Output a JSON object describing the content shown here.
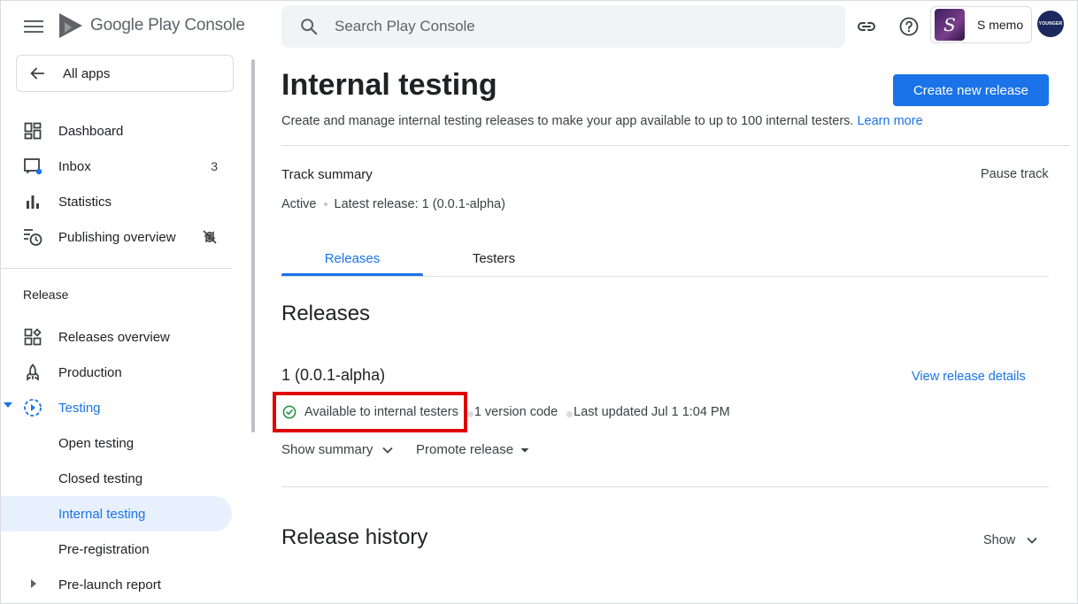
{
  "header": {
    "logo_text": "Google Play Console",
    "search_placeholder": "Search Play Console",
    "app_name": "S memo",
    "avatar_text": "YOUNGER"
  },
  "sidebar": {
    "all_apps": "All apps",
    "items": [
      {
        "label": "Dashboard",
        "icon": "dashboard-icon"
      },
      {
        "label": "Inbox",
        "icon": "inbox-icon",
        "badge": "3"
      },
      {
        "label": "Statistics",
        "icon": "bar-chart-icon"
      },
      {
        "label": "Publishing overview",
        "icon": "publishing-overview-icon"
      }
    ],
    "section_title": "Release",
    "release_items": [
      {
        "label": "Releases overview",
        "icon": "releases-overview-icon"
      },
      {
        "label": "Production",
        "icon": "production-icon"
      },
      {
        "label": "Testing",
        "icon": "testing-icon"
      },
      {
        "label": "Open testing"
      },
      {
        "label": "Closed testing"
      },
      {
        "label": "Internal testing"
      },
      {
        "label": "Pre-registration"
      },
      {
        "label": "Pre-launch report"
      }
    ]
  },
  "main": {
    "title": "Internal testing",
    "create_button": "Create new release",
    "description": "Create and manage internal testing releases to make your app available to up to 100 internal testers.",
    "learn_more": "Learn more",
    "track_summary": "Track summary",
    "pause_track": "Pause track",
    "track_state": "Active",
    "latest_release": "Latest release: 1 (0.0.1-alpha)",
    "tabs": [
      "Releases",
      "Testers"
    ],
    "releases_heading": "Releases",
    "release": {
      "name": "1 (0.0.1-alpha)",
      "view_details": "View release details",
      "status": "Available to internal testers",
      "version_codes": "1 version code",
      "last_updated": "Last updated Jul 1 1:04 PM",
      "show_summary": "Show summary",
      "promote": "Promote release"
    },
    "history_heading": "Release history",
    "history_show": "Show"
  },
  "colors": {
    "accent": "#1a73e8",
    "highlight_box": "#e00000",
    "success": "#1e8e3e"
  }
}
